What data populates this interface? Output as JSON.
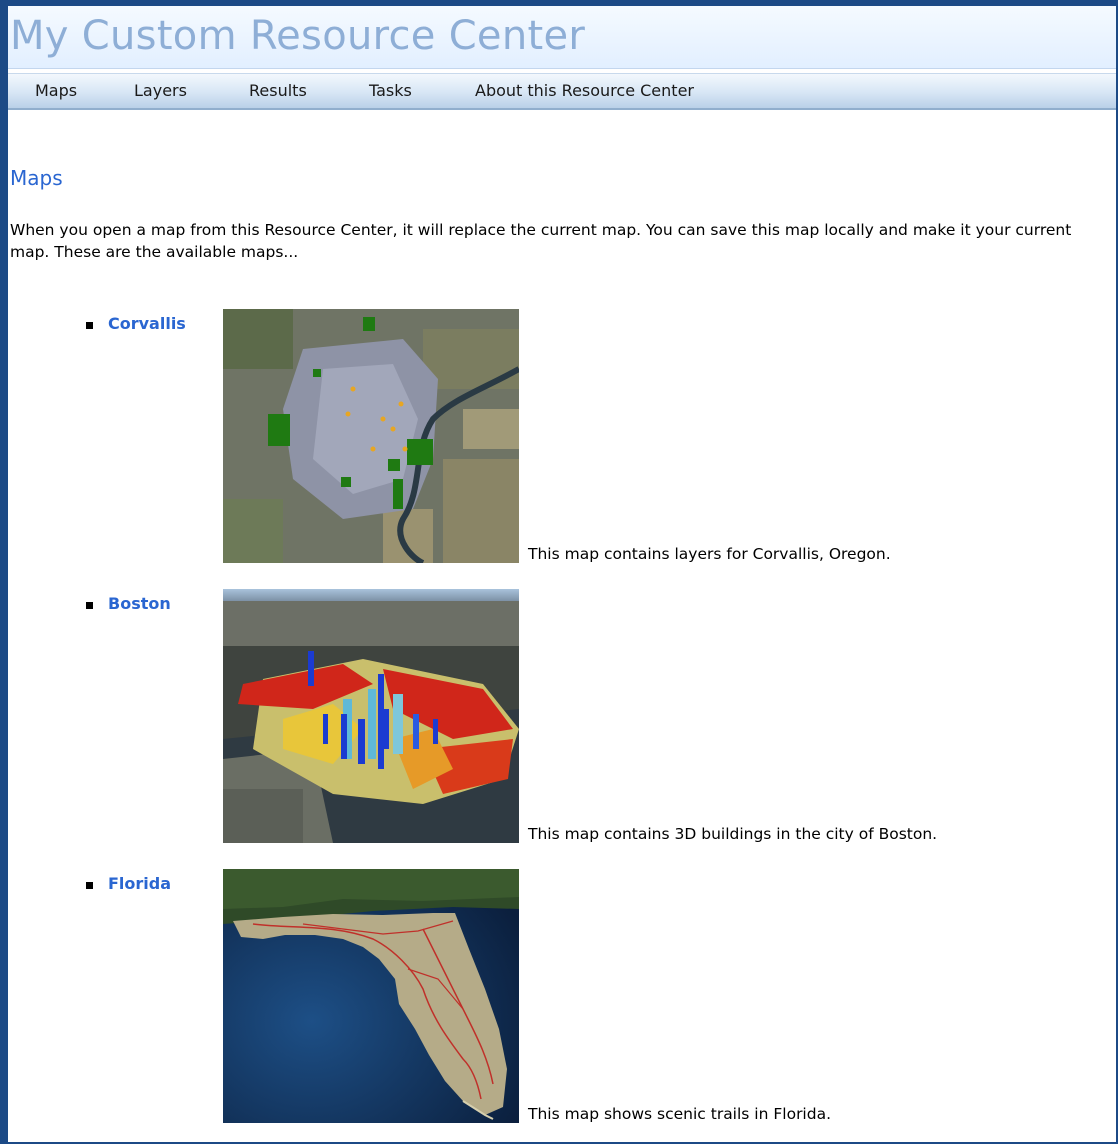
{
  "header": {
    "title": "My Custom Resource Center"
  },
  "nav": {
    "items": [
      {
        "label": "Maps"
      },
      {
        "label": "Layers"
      },
      {
        "label": "Results"
      },
      {
        "label": "Tasks"
      },
      {
        "label": "About this Resource Center"
      }
    ]
  },
  "main": {
    "section_title": "Maps",
    "intro": "When you open a map from this Resource Center, it will replace the current map. You can save this map locally and make it your current map. These are the available maps...",
    "maps": [
      {
        "name": "Corvallis",
        "description": "This map contains layers for Corvallis, Oregon."
      },
      {
        "name": "Boston",
        "description": "This map contains 3D buildings in the city of Boston."
      },
      {
        "name": "Florida",
        "description": "This map shows scenic trails in Florida."
      }
    ]
  },
  "colors": {
    "background": "#1c4a86",
    "title": "#8eaed6",
    "link": "#2a66d1",
    "nav_bar": "#d7e6f5"
  }
}
